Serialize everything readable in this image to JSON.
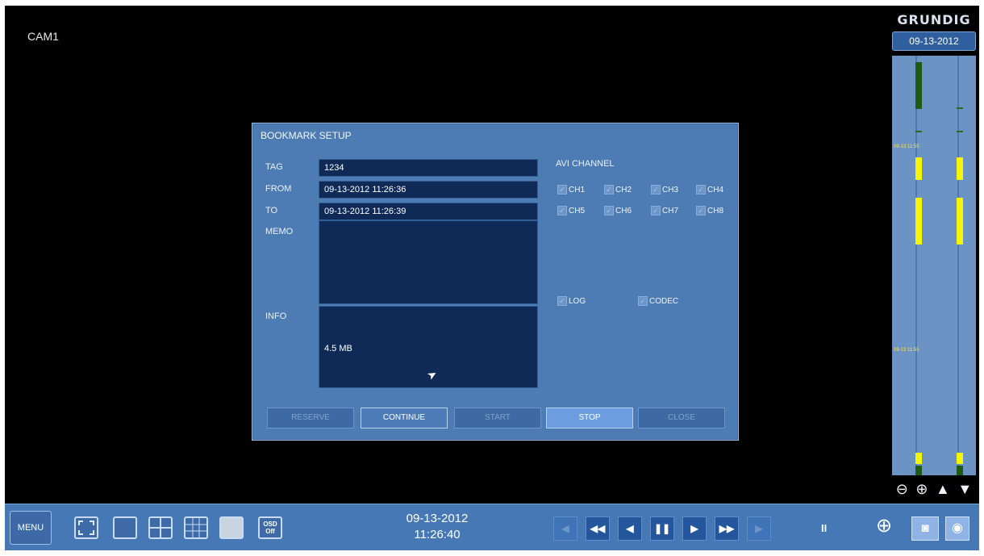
{
  "camera": {
    "label": "CAM1"
  },
  "timeline": {
    "brand": "GRUNDIG",
    "date": "09-13-2012",
    "marks": [
      "09-13 11:55",
      "09-13 11:55"
    ],
    "zoom_out_icon": "zoom-out-icon",
    "zoom_in_icon": "zoom-in-icon",
    "scroll_up_icon": "triangle-up-icon",
    "scroll_down_icon": "triangle-down-icon",
    "bar_color_active": "#f5f50a",
    "bar_color_recorded": "#1e5a14"
  },
  "dialog": {
    "title": "BOOKMARK SETUP",
    "tag_label": "TAG",
    "tag_value": "1234",
    "from_label": "FROM",
    "from_value": "09-13-2012 11:26:36",
    "to_label": "TO",
    "to_value": "09-13-2012 11:26:39",
    "memo_label": "MEMO",
    "info_label": "INFO",
    "info_value": "4.5 MB",
    "avi_channel_label": "AVI CHANNEL",
    "channels": [
      "CH1",
      "CH2",
      "CH3",
      "CH4",
      "CH5",
      "CH6",
      "CH7",
      "CH8"
    ],
    "log_label": "LOG",
    "codec_label": "CODEC",
    "buttons": {
      "reserve": "RESERVE",
      "continue": "CONTINUE",
      "start": "START",
      "stop": "STOP",
      "close": "CLOSE"
    }
  },
  "bottom_bar": {
    "menu_label": "MENU",
    "osd_label_1": "OSD",
    "osd_label_2": "Off",
    "date": "09-13-2012",
    "time": "11:26:40",
    "pause_indicator": "II",
    "playback_icons": [
      "prev-frame-icon",
      "fast-rewind-icon",
      "rewind-icon",
      "pause-icon",
      "play-icon",
      "fast-forward-icon",
      "next-frame-icon"
    ],
    "accent_color": "#4778b6"
  }
}
